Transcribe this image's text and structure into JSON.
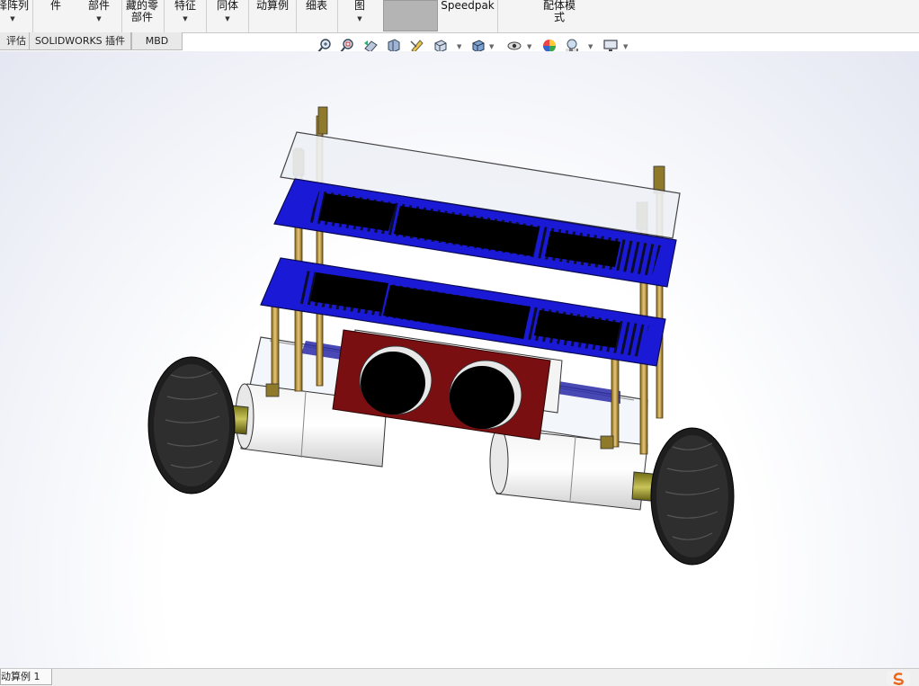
{
  "ribbon": {
    "items": [
      {
        "line1": "择阵列",
        "line2": "",
        "dropdown": true
      },
      {
        "line1": "件",
        "line2": "",
        "dropdown": false
      },
      {
        "line1": "部件",
        "line2": "",
        "dropdown": true
      },
      {
        "line1": "藏的零",
        "line2": "部件",
        "dropdown": false
      },
      {
        "line1": "特征",
        "line2": "",
        "dropdown": true
      },
      {
        "line1": "同体",
        "line2": "",
        "dropdown": true
      },
      {
        "line1": "动算例",
        "line2": "",
        "dropdown": false
      },
      {
        "line1": "细表",
        "line2": "",
        "dropdown": false
      },
      {
        "line1": "图",
        "line2": "",
        "dropdown": true
      },
      {
        "line1": "Speedpak",
        "line2": "",
        "dropdown": false
      },
      {
        "line1": "配体模",
        "line2": "式",
        "dropdown": false
      }
    ]
  },
  "tabs": [
    "评估",
    "SOLIDWORKS 插件",
    "MBD"
  ],
  "hud_icons": [
    "zoom-to-fit-icon",
    "zoom-to-area-icon",
    "previous-view-icon",
    "section-view-icon",
    "dynamic-annotation-icon",
    "view-orientation-icon",
    "display-style-icon",
    "hide-show-items-icon",
    "edit-appearance-icon",
    "apply-scene-icon",
    "view-settings-icon"
  ],
  "bottom_tab": "动算例 1",
  "colors": {
    "plate_blue": "#1a1ad6",
    "sensor_red": "#7a0f12",
    "standoff_brass": "#c9a14a",
    "tire_dark": "#2a2a2a"
  }
}
